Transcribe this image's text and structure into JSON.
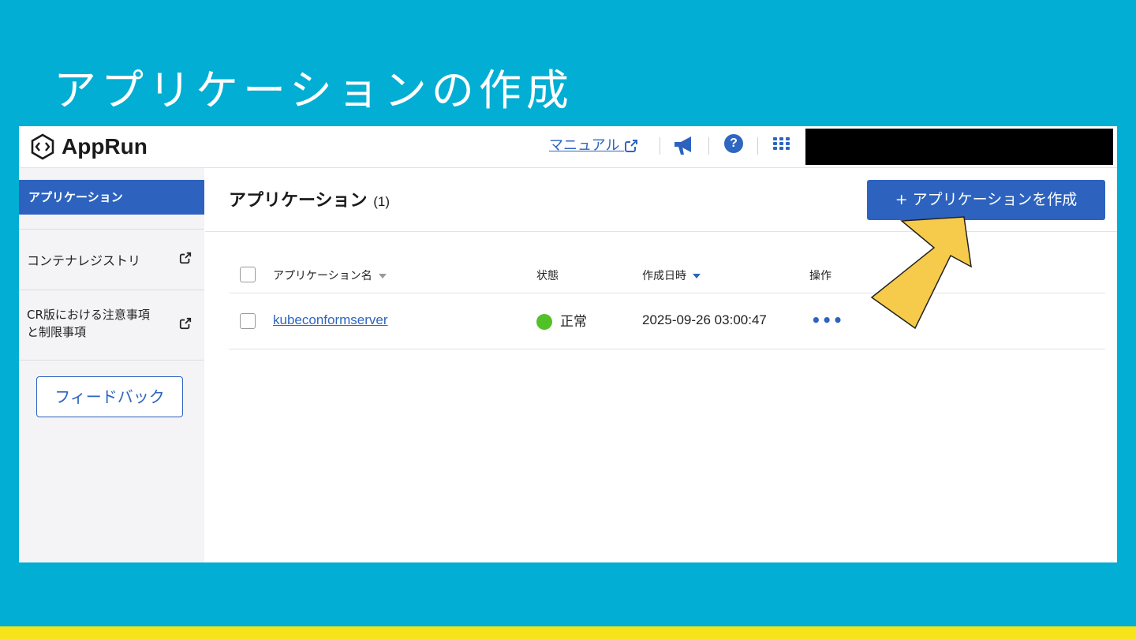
{
  "slide": {
    "title": "アプリケーションの作成"
  },
  "topbar": {
    "logo_text": "AppRun",
    "manual_link": "マニュアル",
    "help_glyph": "?"
  },
  "sidebar": {
    "items": [
      {
        "label": "アプリケーション",
        "active": true
      },
      {
        "label": "コンテナレジストリ",
        "external": true
      },
      {
        "label_line1": "CR版における注意事項",
        "label_line2": "と制限事項",
        "external": true
      }
    ],
    "feedback_label": "フィードバック"
  },
  "main": {
    "title": "アプリケーション",
    "count": "(1)",
    "create_button": "+ アプリケーションを作成",
    "table": {
      "headers": [
        "アプリケーション名",
        "状態",
        "作成日時",
        "操作"
      ],
      "rows": [
        {
          "name": "kubeconformserver",
          "status": "正常",
          "status_color": "#52c128",
          "created": "2025-09-26 03:00:47",
          "ops": "•••"
        }
      ]
    }
  },
  "colors": {
    "background": "#02aed3",
    "accent": "#2d63bf",
    "highlight_bar": "#f6e319",
    "arrow": "#f6ca4a"
  },
  "icons": [
    "apprun-logo-icon",
    "external-link-icon",
    "megaphone-icon",
    "help-icon",
    "apps-grid-icon",
    "sort-down-icon",
    "arrow-annotation"
  ]
}
